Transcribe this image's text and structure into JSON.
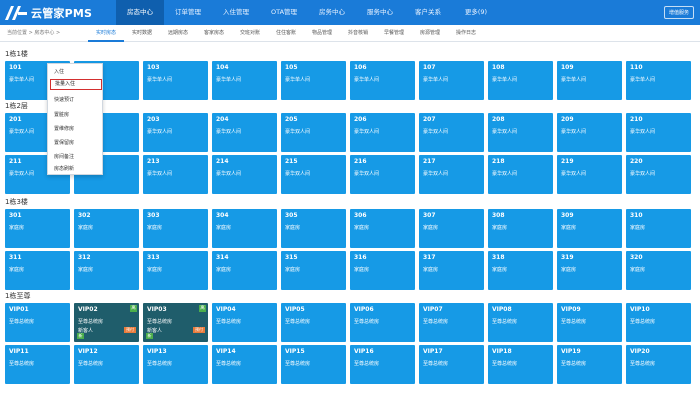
{
  "app": {
    "title": "云管家PMS",
    "user_button": "增值服务",
    "nav": [
      {
        "label": "房态中心",
        "active": true
      },
      {
        "label": "订单管理",
        "active": false
      },
      {
        "label": "入住管理",
        "active": false
      },
      {
        "label": "OTA管理",
        "active": false
      },
      {
        "label": "房务中心",
        "active": false
      },
      {
        "label": "服务中心",
        "active": false
      },
      {
        "label": "客户关系",
        "active": false
      },
      {
        "label": "更多(9)",
        "active": false
      }
    ]
  },
  "breadcrumb": "当前位置 > 房态中心 >",
  "subtabs": [
    {
      "label": "实时房态",
      "active": true
    },
    {
      "label": "实时数据",
      "active": false
    },
    {
      "label": "远期房态",
      "active": false
    },
    {
      "label": "客家房态",
      "active": false
    },
    {
      "label": "交班对账",
      "active": false
    },
    {
      "label": "住住客账",
      "active": false
    },
    {
      "label": "物品管理",
      "active": false
    },
    {
      "label": "抖音核销",
      "active": false
    },
    {
      "label": "早餐管理",
      "active": false
    },
    {
      "label": "房源管理",
      "active": false
    },
    {
      "label": "操作日志",
      "active": false
    }
  ],
  "sections": [
    {
      "title": "1栋1楼",
      "rows": [
        [
          {
            "num": "101",
            "type": "豪华单人间"
          },
          {
            "num": "",
            "type": ""
          },
          {
            "num": "103",
            "type": "豪华单人间"
          },
          {
            "num": "104",
            "type": "豪华单人间"
          },
          {
            "num": "105",
            "type": "豪华单人间"
          },
          {
            "num": "106",
            "type": "豪华单人间"
          },
          {
            "num": "107",
            "type": "豪华单人间"
          },
          {
            "num": "108",
            "type": "豪华单人间"
          },
          {
            "num": "109",
            "type": "豪华单人间"
          },
          {
            "num": "110",
            "type": "豪华单人间"
          }
        ]
      ]
    },
    {
      "title": "1栋2层",
      "rows": [
        [
          {
            "num": "201",
            "type": "豪华双人间"
          },
          {
            "num": "",
            "type": ""
          },
          {
            "num": "203",
            "type": "豪华双人间"
          },
          {
            "num": "204",
            "type": "豪华双人间"
          },
          {
            "num": "205",
            "type": "豪华双人间"
          },
          {
            "num": "206",
            "type": "豪华双人间"
          },
          {
            "num": "207",
            "type": "豪华双人间"
          },
          {
            "num": "208",
            "type": "豪华双人间"
          },
          {
            "num": "209",
            "type": "豪华双人间"
          },
          {
            "num": "210",
            "type": "豪华双人间"
          }
        ],
        [
          {
            "num": "211",
            "type": "豪华双人间"
          },
          {
            "num": "",
            "type": ""
          },
          {
            "num": "213",
            "type": "豪华双人间"
          },
          {
            "num": "214",
            "type": "豪华双人间"
          },
          {
            "num": "215",
            "type": "豪华双人间"
          },
          {
            "num": "216",
            "type": "豪华双人间"
          },
          {
            "num": "217",
            "type": "豪华双人间"
          },
          {
            "num": "218",
            "type": "豪华双人间"
          },
          {
            "num": "219",
            "type": "豪华双人间"
          },
          {
            "num": "220",
            "type": "豪华双人间"
          }
        ]
      ]
    },
    {
      "title": "1栋3楼",
      "rows": [
        [
          {
            "num": "301",
            "type": "家庭房"
          },
          {
            "num": "302",
            "type": "家庭房"
          },
          {
            "num": "303",
            "type": "家庭房"
          },
          {
            "num": "304",
            "type": "家庭房"
          },
          {
            "num": "305",
            "type": "家庭房"
          },
          {
            "num": "306",
            "type": "家庭房"
          },
          {
            "num": "307",
            "type": "家庭房"
          },
          {
            "num": "308",
            "type": "家庭房"
          },
          {
            "num": "309",
            "type": "家庭房"
          },
          {
            "num": "310",
            "type": "家庭房"
          }
        ],
        [
          {
            "num": "311",
            "type": "家庭房"
          },
          {
            "num": "312",
            "type": "家庭房"
          },
          {
            "num": "313",
            "type": "家庭房"
          },
          {
            "num": "314",
            "type": "家庭房"
          },
          {
            "num": "315",
            "type": "家庭房"
          },
          {
            "num": "316",
            "type": "家庭房"
          },
          {
            "num": "317",
            "type": "家庭房"
          },
          {
            "num": "318",
            "type": "家庭房"
          },
          {
            "num": "319",
            "type": "家庭房"
          },
          {
            "num": "320",
            "type": "家庭房"
          }
        ]
      ]
    },
    {
      "title": "1栋至尊",
      "rows": [
        [
          {
            "num": "VIP01",
            "type": "至尊总统房"
          },
          {
            "num": "VIP02",
            "type": "至尊总统房",
            "occupied": true,
            "guest": "新客人",
            "flag": "离",
            "due": "预付"
          },
          {
            "num": "VIP03",
            "type": "至尊总统房",
            "occupied": true,
            "guest": "新客人",
            "flag": "离",
            "due": "预付"
          },
          {
            "num": "VIP04",
            "type": "至尊总统房"
          },
          {
            "num": "VIP05",
            "type": "至尊总统房"
          },
          {
            "num": "VIP06",
            "type": "至尊总统房"
          },
          {
            "num": "VIP07",
            "type": "至尊总统房"
          },
          {
            "num": "VIP08",
            "type": "至尊总统房"
          },
          {
            "num": "VIP09",
            "type": "至尊总统房"
          },
          {
            "num": "VIP10",
            "type": "至尊总统房"
          }
        ],
        [
          {
            "num": "VIP11",
            "type": "至尊总统房"
          },
          {
            "num": "VIP12",
            "type": "至尊总统房"
          },
          {
            "num": "VIP13",
            "type": "至尊总统房"
          },
          {
            "num": "VIP14",
            "type": "至尊总统房"
          },
          {
            "num": "VIP15",
            "type": "至尊总统房"
          },
          {
            "num": "VIP16",
            "type": "至尊总统房"
          },
          {
            "num": "VIP17",
            "type": "至尊总统房"
          },
          {
            "num": "VIP18",
            "type": "至尊总统房"
          },
          {
            "num": "VIP19",
            "type": "至尊总统房"
          },
          {
            "num": "VIP20",
            "type": "至尊总统房"
          }
        ]
      ]
    }
  ],
  "context_menu": {
    "items": [
      "入住",
      "批量入住",
      "快速预订",
      "置脏房",
      "置维修房",
      "置保留房",
      "房间备注",
      "房态刷新"
    ],
    "highlighted_index": 1
  },
  "room_badge_new": "新",
  "colors": {
    "brand_blue": "#1a7bd8",
    "room_vacant": "#169ae6",
    "room_occupied": "#1f5d6b",
    "menu_highlight_border": "#d32f2f"
  }
}
